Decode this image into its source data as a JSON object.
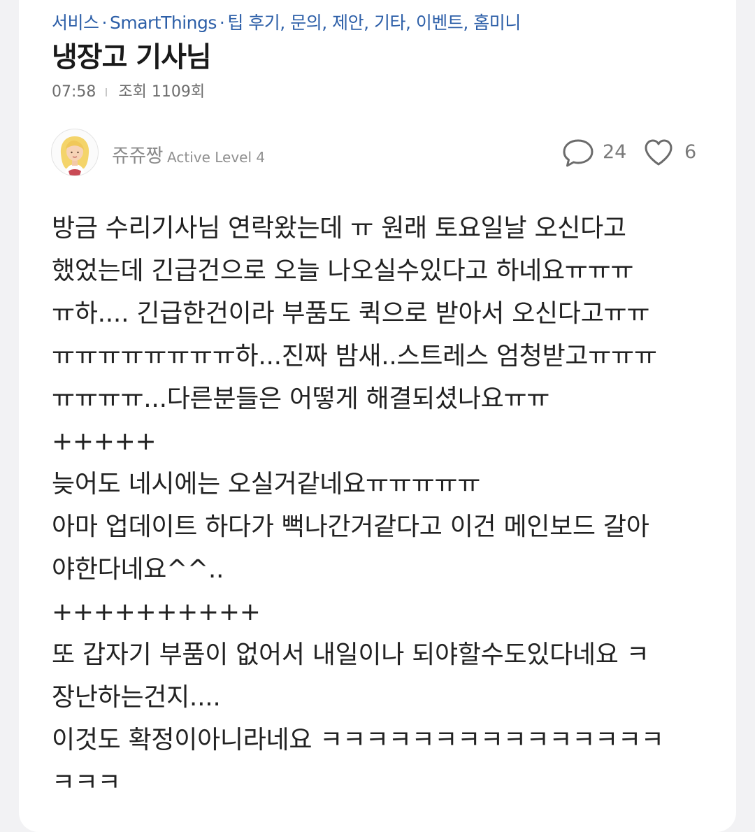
{
  "breadcrumb": {
    "items": [
      "서비스",
      "SmartThings",
      "팁 후기, 문의, 제안, 기타, 이벤트, 홈미니"
    ],
    "separator": "·"
  },
  "post": {
    "title": "냉장고 기사님",
    "time": "07:58",
    "views": "조회 1109회"
  },
  "author": {
    "name": "쥬쥬짱",
    "level": "Active Level 4"
  },
  "stats": {
    "comments": "24",
    "likes": "6"
  },
  "body": {
    "lines": [
      "방금 수리기사님 연락왔는데 ㅠ 원래 토요일날 오신다고",
      "했었는데 긴급건으로 오늘 나오실수있다고 하네요ㅠㅠㅠ",
      "ㅠ하.... 긴급한건이라 부품도 퀵으로 받아서 오신다고ㅠㅠ",
      "ㅠㅠㅠㅠㅠㅠㅠㅠ하...진짜 밤새..스트레스 엄청받고ㅠㅠㅠ",
      "ㅠㅠㅠㅠ...다른분들은 어떻게 해결되셨나요ㅠㅠ",
      "+++++",
      "늦어도 네시에는 오실거같네요ㅠㅠㅠㅠㅠ",
      "아마 업데이트 하다가 뻑나간거같다고 이건 메인보드 갈아",
      "야한다네요^^..",
      "++++++++++",
      "또 갑자기 부품이 없어서 내일이나 되야할수도있다네요 ㅋ",
      "장난하는건지....",
      "이것도 확정이아니라네요 ㅋㅋㅋㅋㅋㅋㅋㅋㅋㅋㅋㅋㅋㅋㅋ",
      "ㅋㅋㅋ"
    ]
  },
  "icons": {
    "comment": "speech-bubble-icon",
    "like": "heart-outline-icon",
    "avatar": "woman-avatar-illustration"
  },
  "colors": {
    "breadcrumb": "#2d5fa8",
    "title": "#1a1a1a",
    "body_text": "#222222",
    "muted": "#8a8a8a",
    "background": "#f2f2f4",
    "card": "#ffffff"
  }
}
